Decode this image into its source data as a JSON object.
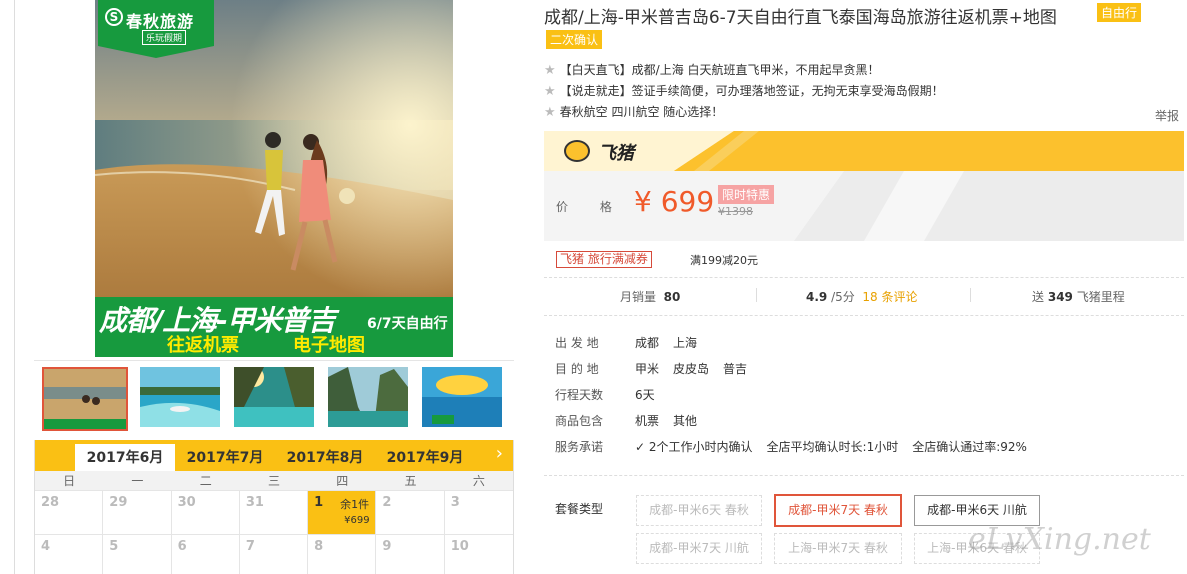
{
  "colors": {
    "accent": "#fac014",
    "price": "#f05a2a",
    "selected": "#e0553a",
    "banner_green": "#179a3e"
  },
  "main_image": {
    "logo_text": "春秋旅游",
    "logo_sub": "乐玩假期",
    "banner_title": "成都/上海-甲米普吉",
    "banner_days": "6/7天自由行",
    "banner_sub1": "往返机票",
    "banner_sub2": "电子地图"
  },
  "thumbnails": [
    "thumb-beach-couple",
    "thumb-island-boat",
    "thumb-lagoon",
    "thumb-cliffs",
    "thumb-jiami-poster"
  ],
  "calendar": {
    "tabs": [
      "2017年6月",
      "2017年7月",
      "2017年8月",
      "2017年9月"
    ],
    "next_icon": "›",
    "weekdays": [
      "日",
      "一",
      "二",
      "三",
      "四",
      "五",
      "六"
    ],
    "days": [
      {
        "d": "28"
      },
      {
        "d": "29"
      },
      {
        "d": "30"
      },
      {
        "d": "31"
      },
      {
        "d": "1",
        "rem": "余1件",
        "price": "¥699"
      },
      {
        "d": "2"
      },
      {
        "d": "3"
      },
      {
        "d": "4"
      },
      {
        "d": "5"
      },
      {
        "d": "6"
      },
      {
        "d": "7"
      },
      {
        "d": "8"
      },
      {
        "d": "9"
      },
      {
        "d": "10"
      }
    ]
  },
  "product": {
    "title": "成都/上海-甲米普吉岛6-7天自由行直飞泰国海岛旅游往返机票+地图",
    "tag_free": "自由行",
    "tag_confirm": "二次确认",
    "features": [
      "【白天直飞】成都/上海 白天航班直飞甲米，不用起早贪黑！",
      "【说走就走】签证手续简便，可办理落地签证，无拘无束享受海岛假期！",
      "春秋航空 四川航空 随心选择！"
    ],
    "report": "举报"
  },
  "fliggy": {
    "name": "飞猪"
  },
  "price": {
    "label": "价 格",
    "current": "¥ 699",
    "limited": "限时特惠",
    "original": "¥1398"
  },
  "coupon": {
    "label": "飞猪 旅行满减券",
    "desc": "满199减20元"
  },
  "stats": {
    "sales_label": "月销量",
    "sales": "80",
    "score": "4.9",
    "score_unit": "/5分",
    "reviews": "18 条评论",
    "miles_pre": "送",
    "miles": "349",
    "miles_post": "飞猪里程"
  },
  "info": {
    "departure_label": "出 发 地",
    "departure": [
      "成都",
      "上海"
    ],
    "dest_label": "目 的 地",
    "dest": [
      "甲米",
      "皮皮岛",
      "普吉"
    ],
    "days_label": "行程天数",
    "days": "6天",
    "includes_label": "商品包含",
    "includes": [
      "机票",
      "其他"
    ],
    "service_label": "服务承诺",
    "service": [
      "2个工作小时内确认",
      "全店平均确认时长:1小时",
      "全店确认通过率:92%"
    ]
  },
  "packages": {
    "label": "套餐类型",
    "items": [
      {
        "label": "成都-甲米6天 春秋",
        "state": "dis"
      },
      {
        "label": "成都-甲米7天 春秋",
        "state": "sel"
      },
      {
        "label": "成都-甲米6天 川航",
        "state": "norm"
      },
      {
        "label": "成都-甲米7天 川航",
        "state": "dis"
      },
      {
        "label": "上海-甲米7天 春秋",
        "state": "dis"
      },
      {
        "label": "上海-甲米6天 春秋",
        "state": "dis"
      }
    ]
  },
  "watermark": "eLvXing.net"
}
